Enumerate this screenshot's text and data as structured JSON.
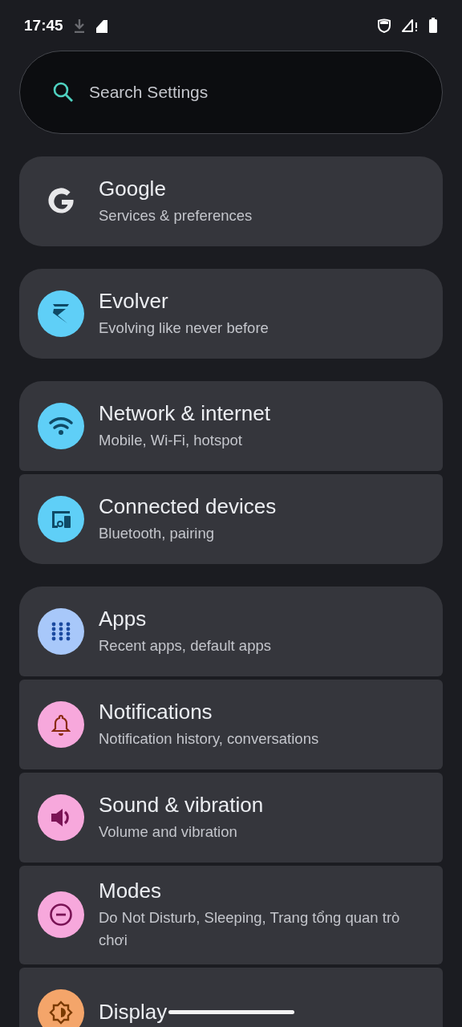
{
  "status_bar": {
    "time": "17:45"
  },
  "search": {
    "placeholder": "Search Settings"
  },
  "groups": [
    {
      "items": [
        {
          "kind": "google",
          "title": "Google",
          "subtitle": "Services & preferences"
        }
      ]
    },
    {
      "items": [
        {
          "kind": "evolver",
          "color": "#5fcff7",
          "title": "Evolver",
          "subtitle": "Evolving like never before"
        }
      ]
    },
    {
      "items": [
        {
          "kind": "wifi",
          "color": "#5fcff7",
          "title": "Network & internet",
          "subtitle": "Mobile, Wi-Fi, hotspot"
        },
        {
          "kind": "devices",
          "color": "#5fcff7",
          "title": "Connected devices",
          "subtitle": "Bluetooth, pairing"
        }
      ]
    },
    {
      "items": [
        {
          "kind": "apps",
          "color": "#a8c8fa",
          "title": "Apps",
          "subtitle": "Recent apps, default apps"
        },
        {
          "kind": "bell",
          "color": "#f7a8dc",
          "title": "Notifications",
          "subtitle": "Notification history, conversations"
        },
        {
          "kind": "sound",
          "color": "#f7a8dc",
          "title": "Sound & vibration",
          "subtitle": "Volume and vibration"
        },
        {
          "kind": "modes",
          "color": "#f7a8dc",
          "title": "Modes",
          "subtitle": "Do Not Disturb, Sleeping, Trang tổng quan trò chơi"
        },
        {
          "kind": "display",
          "color": "#f4a56a",
          "title": "Display"
        }
      ]
    }
  ]
}
